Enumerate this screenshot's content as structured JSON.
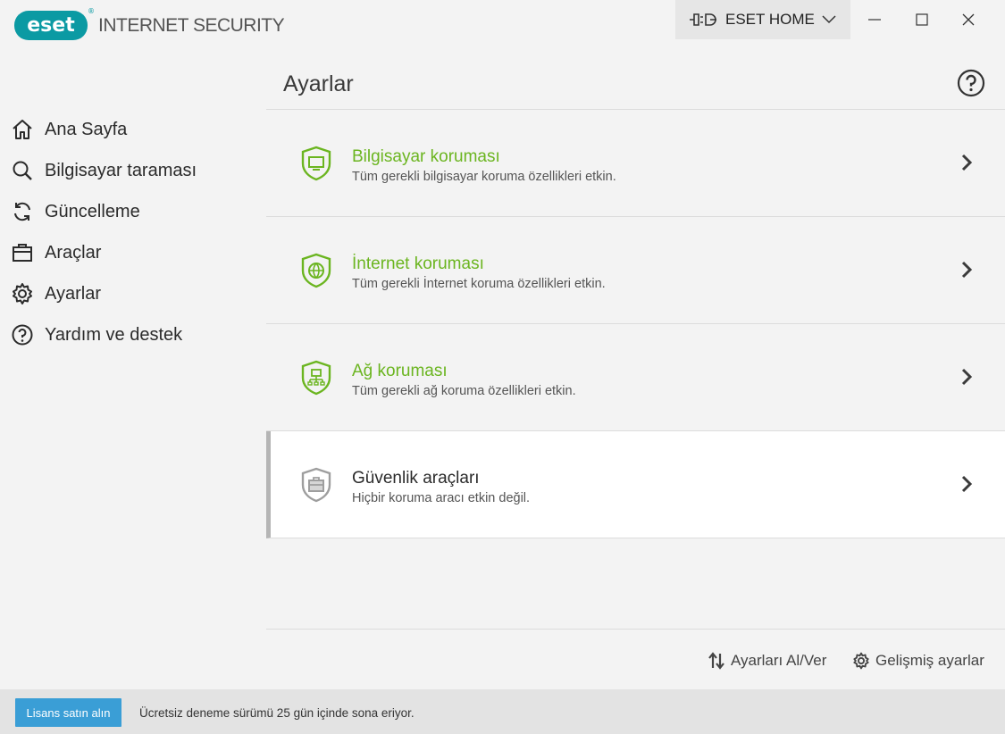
{
  "app": {
    "logo_text": "eset",
    "product_name": "INTERNET SECURITY",
    "home_button": "ESET HOME"
  },
  "colors": {
    "accent_green": "#6bb520",
    "brand_teal": "#0b9aa3",
    "button_blue": "#3a9ed6"
  },
  "sidebar": {
    "items": [
      {
        "label": "Ana Sayfa",
        "icon": "home-icon"
      },
      {
        "label": "Bilgisayar taraması",
        "icon": "search-icon"
      },
      {
        "label": "Güncelleme",
        "icon": "refresh-icon"
      },
      {
        "label": "Araçlar",
        "icon": "toolbox-icon"
      },
      {
        "label": "Ayarlar",
        "icon": "gear-icon",
        "active": true
      },
      {
        "label": "Yardım ve destek",
        "icon": "help-icon"
      }
    ]
  },
  "main": {
    "title": "Ayarlar",
    "cards": [
      {
        "title": "Bilgisayar koruması",
        "desc": "Tüm gerekli bilgisayar koruma özellikleri etkin.",
        "icon": "computer-shield-icon"
      },
      {
        "title": "İnternet koruması",
        "desc": "Tüm gerekli İnternet koruma özellikleri etkin.",
        "icon": "globe-shield-icon"
      },
      {
        "title": "Ağ koruması",
        "desc": "Tüm gerekli ağ koruma özellikleri etkin.",
        "icon": "network-shield-icon"
      },
      {
        "title": "Güvenlik araçları",
        "desc": "Hiçbir koruma aracı etkin değil.",
        "icon": "toolbox-shield-icon"
      }
    ],
    "import_export_label": "Ayarları Al/Ver",
    "advanced_label": "Gelişmiş ayarlar"
  },
  "footer": {
    "buy_button": "Lisans satın alın",
    "trial_text": "Ücretsiz deneme sürümü 25 gün içinde sona eriyor."
  }
}
